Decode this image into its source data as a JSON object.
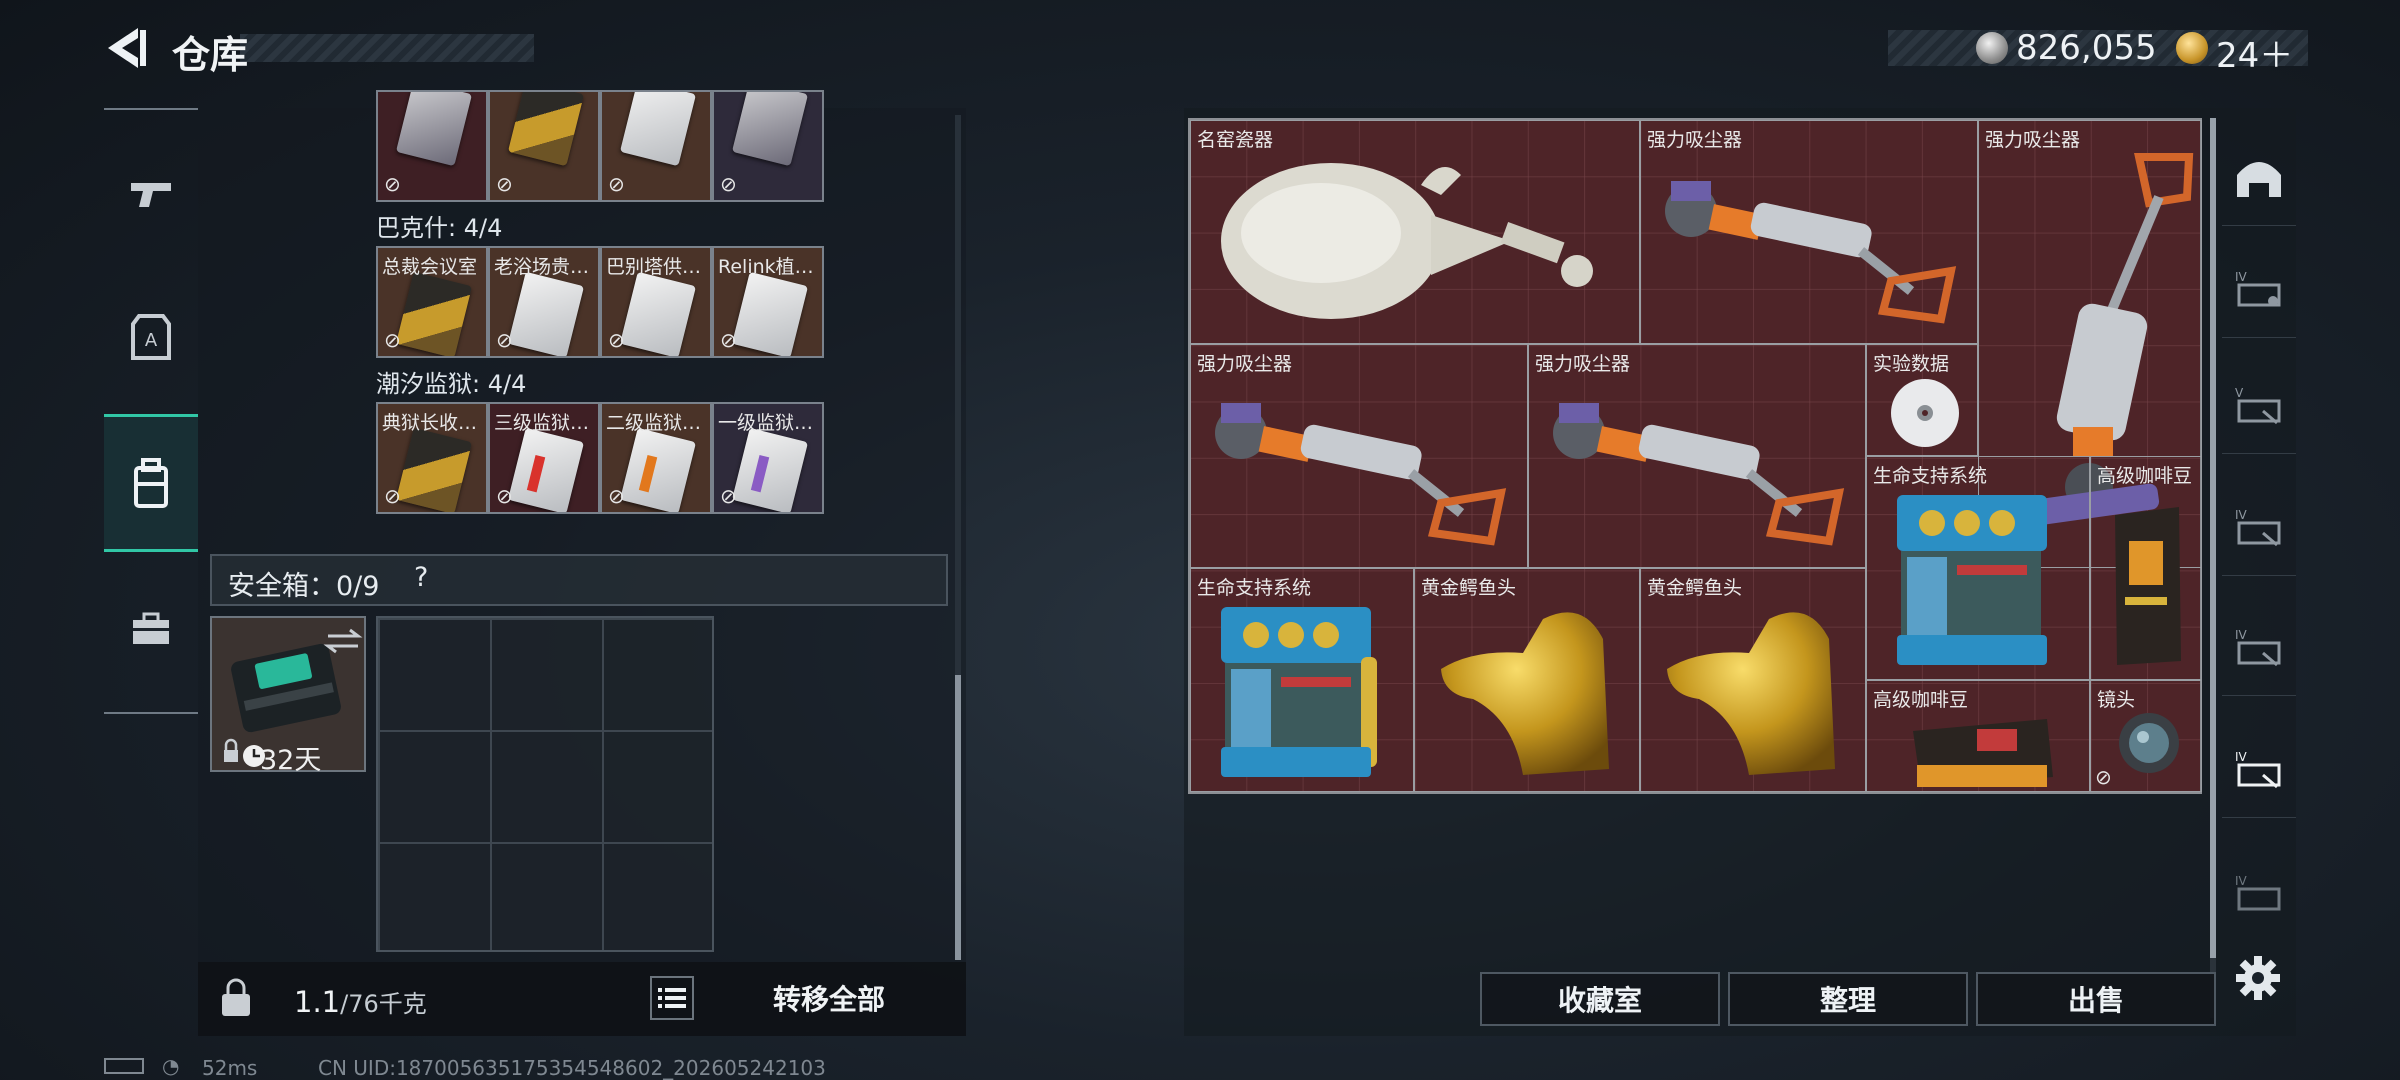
{
  "header": {
    "title": "仓库"
  },
  "currency": {
    "money": "826,055",
    "tokens": "24＋"
  },
  "left_rail": {
    "items": [
      "gun-icon",
      "armor-icon",
      "backpack-icon",
      "case-icon"
    ],
    "active": 2
  },
  "keycards": {
    "top_row": [
      {
        "label": "",
        "style": "dark"
      },
      {
        "label": "",
        "style": "gold"
      },
      {
        "label": "",
        "style": "dark"
      },
      {
        "label": "",
        "style": "dark"
      }
    ],
    "group1": {
      "label": "巴克什: 4/4",
      "cards": [
        {
          "label": "总裁会议室",
          "style": "gold"
        },
        {
          "label": "老浴场贵…",
          "style": "dark"
        },
        {
          "label": "巴别塔供…",
          "style": "dark"
        },
        {
          "label": "Relink植…",
          "style": "dark"
        }
      ]
    },
    "group2": {
      "label": "潮汐监狱: 4/4",
      "cards": [
        {
          "label": "典狱长收…",
          "style": "gold"
        },
        {
          "label": "三级监狱…",
          "style": "red"
        },
        {
          "label": "二级监狱…",
          "style": "orange"
        },
        {
          "label": "一级监狱…",
          "style": "purple"
        }
      ]
    }
  },
  "safe": {
    "label": "安全箱：0/9",
    "help": "?",
    "timer": "32天"
  },
  "weight": {
    "current": "1.1",
    "max": "/76千克"
  },
  "buttons": {
    "transfer_all": "转移全部",
    "collection": "收藏室",
    "organize": "整理",
    "sell": "出售"
  },
  "inventory": {
    "items": [
      {
        "label": "名窑瓷器"
      },
      {
        "label": "强力吸尘器"
      },
      {
        "label": "强力吸尘器"
      },
      {
        "label": "强力吸尘器"
      },
      {
        "label": "强力吸尘器"
      },
      {
        "label": "实验数据"
      },
      {
        "label": "生命支持系统"
      },
      {
        "label": "高级咖啡豆"
      },
      {
        "label": "生命支持系统"
      },
      {
        "label": "黄金鳄鱼头"
      },
      {
        "label": "黄金鳄鱼头"
      },
      {
        "label": "高级咖啡豆"
      },
      {
        "label": "镜头"
      }
    ]
  },
  "status_bar": {
    "ping": "52ms",
    "uid": "CN UID:187005635175354548602_202605242103"
  }
}
